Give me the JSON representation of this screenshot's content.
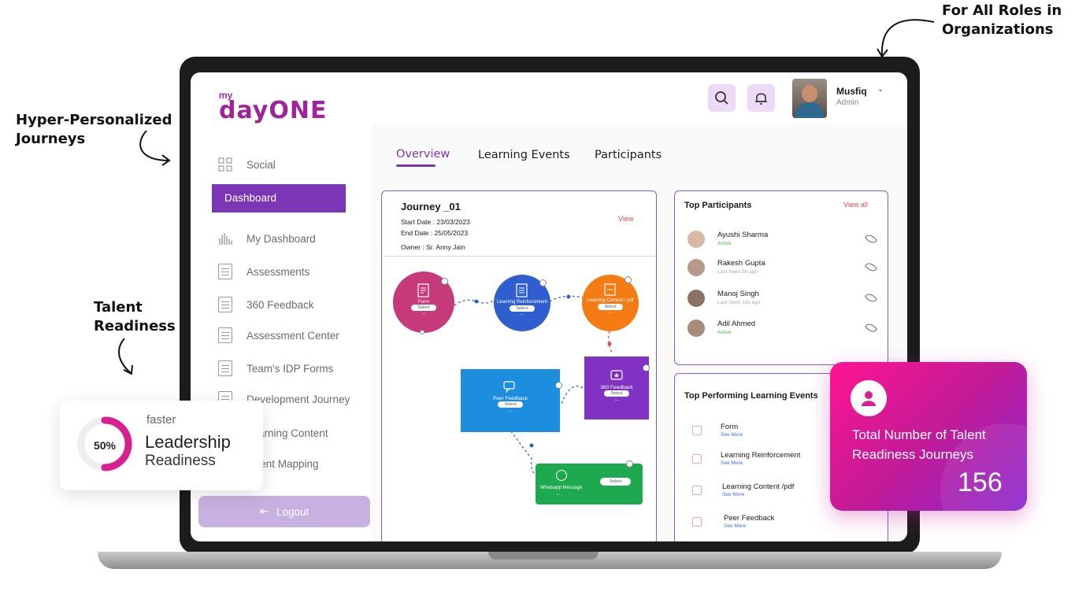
{
  "callouts": {
    "top_right": "For All Roles in Organizations",
    "left_top": "Hyper-Personalized Journeys",
    "left_mid": "Talent Readiness"
  },
  "app": {
    "logo_small": "my",
    "logo_main": "dayONE"
  },
  "header": {
    "user_name": "Musfiq",
    "user_role": "Admin"
  },
  "sidebar": {
    "social": "Social",
    "active": "Dashboard",
    "items": [
      "My Dashboard",
      "Assessments",
      "360 Feedback",
      "Assessment Center",
      "Team's IDP Forms",
      "Development Journey",
      "Learning Content",
      "Talent Mapping"
    ],
    "logout": "Logout"
  },
  "tabs": [
    "Overview",
    "Learning Events",
    "Participants"
  ],
  "journey": {
    "title": "Journey _01",
    "start": "Start Date :  23/03/2023",
    "end": "End Date :  25/05/2023",
    "owner": "Owner :  Sr. Anny Jain",
    "view": "View",
    "nodes": {
      "form": "Form",
      "reinforcement": "Learning Reinforcement",
      "content": "Learning Content / pdf",
      "peer": "Peer Feedback",
      "f360": "360 Feedback",
      "whatsapp": "Whatsapp Message",
      "select": "Select",
      "more": "..."
    }
  },
  "top_participants": {
    "title": "Top Participants",
    "view_all": "View all",
    "rows": [
      {
        "name": "Ayushi Sharma",
        "status": "Active"
      },
      {
        "name": "Rakesh Gupta",
        "status": "Last Seen 5h ago"
      },
      {
        "name": "Manoj Singh",
        "status": "Last Seen 11h ago"
      },
      {
        "name": "Adil Ahmed",
        "status": "Active"
      }
    ]
  },
  "top_events": {
    "title": "Top Performing Learning Events",
    "see_more": "See More",
    "rows": [
      "Form",
      "Learning Reinforcement",
      "Learning Content /pdf",
      "Peer Feedback"
    ]
  },
  "leadership_card": {
    "percent": "50%",
    "percent_value": 0.5,
    "small": "faster",
    "line1": "Leadership",
    "line2": "Readiness"
  },
  "talent_card": {
    "label": "Total Number of Talent Readiness Journeys",
    "value": "156"
  },
  "colors": {
    "brand_purple": "#7b36b6",
    "pink": "#e0137d",
    "form_node": "#c63a7a",
    "reinforcement_node": "#2f5fcf",
    "content_node": "#f57c15",
    "peer_node": "#1d8de0",
    "f360_node": "#8232c3",
    "whatsapp_node": "#1ea94e"
  }
}
